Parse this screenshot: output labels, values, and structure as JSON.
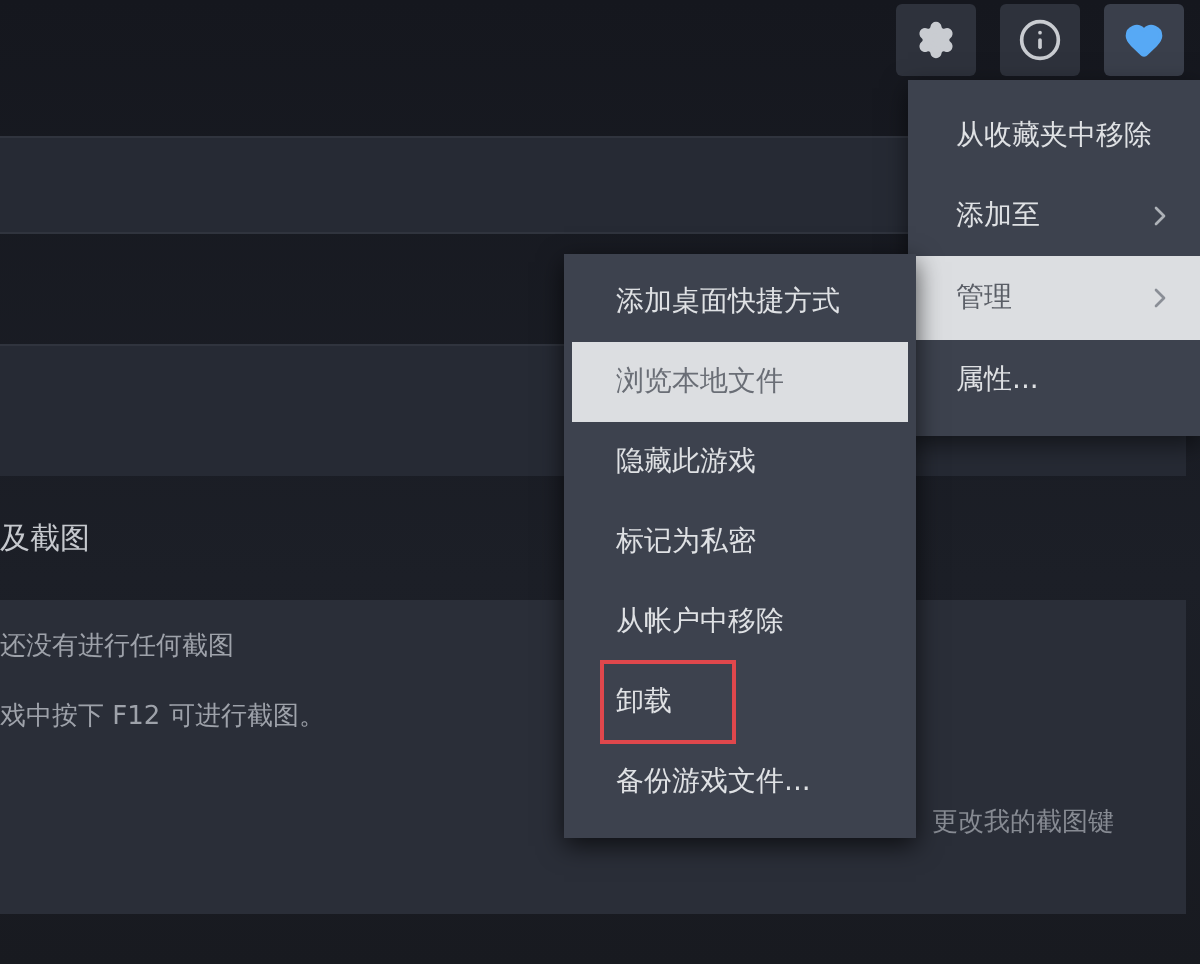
{
  "toolbar": [
    {
      "kind": "settings",
      "selected": false
    },
    {
      "kind": "info",
      "selected": false
    },
    {
      "kind": "favorite",
      "selected": true
    }
  ],
  "section": {
    "title": "及截图",
    "empty_title": "还没有进行任何截图",
    "empty_hint": "戏中按下 F12 可进行截图。",
    "link": "更改我的截图键"
  },
  "menu": [
    {
      "label": "从收藏夹中移除",
      "submenu": false,
      "selected": false
    },
    {
      "label": "添加至",
      "submenu": true,
      "selected": false
    },
    {
      "label": "管理",
      "submenu": true,
      "selected": true
    },
    {
      "label": "属性...",
      "submenu": false,
      "selected": false
    }
  ],
  "submenu": [
    {
      "label": "添加桌面快捷方式",
      "selected": false,
      "outlined": false
    },
    {
      "label": "浏览本地文件",
      "selected": true,
      "outlined": false
    },
    {
      "label": "隐藏此游戏",
      "selected": false,
      "outlined": false
    },
    {
      "label": "标记为私密",
      "selected": false,
      "outlined": false
    },
    {
      "label": "从帐户中移除",
      "selected": false,
      "outlined": false
    },
    {
      "label": "卸载",
      "selected": false,
      "outlined": true
    },
    {
      "label": "备份游戏文件...",
      "selected": false,
      "outlined": false
    }
  ]
}
